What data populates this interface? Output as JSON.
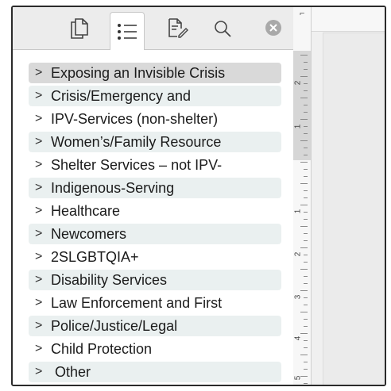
{
  "toolbar": {
    "tools": [
      {
        "icon": "page-thumbnails-icon"
      },
      {
        "icon": "outline-list-icon",
        "selected": true
      },
      {
        "icon": "annotations-icon"
      },
      {
        "icon": "search-icon"
      }
    ],
    "close_icon": "close-circle-icon"
  },
  "outline": {
    "items": [
      {
        "label": "Exposing an Invisible Crisis",
        "chevron": ">",
        "state": "selected"
      },
      {
        "label": "Crisis/Emergency and",
        "chevron": ">",
        "state": "alt"
      },
      {
        "label": "IPV-Services (non-shelter)",
        "chevron": ">",
        "state": ""
      },
      {
        "label": "Women’s/Family Resource",
        "chevron": ">",
        "state": "alt"
      },
      {
        "label": "Shelter Services – not IPV-",
        "chevron": ">",
        "state": ""
      },
      {
        "label": "Indigenous-Serving",
        "chevron": ">",
        "state": "alt"
      },
      {
        "label": "Healthcare",
        "chevron": ">",
        "state": ""
      },
      {
        "label": "Newcomers",
        "chevron": ">",
        "state": "alt"
      },
      {
        "label": "2SLGBTQIA+",
        "chevron": ">",
        "state": ""
      },
      {
        "label": "Disability Services",
        "chevron": ">",
        "state": "alt"
      },
      {
        "label": "Law Enforcement and First",
        "chevron": ">",
        "state": ""
      },
      {
        "label": "Police/Justice/Legal",
        "chevron": ">",
        "state": "alt"
      },
      {
        "label": "Child Protection",
        "chevron": ">",
        "state": ""
      },
      {
        "label": " Other",
        "chevron": ">",
        "state": "alt"
      }
    ]
  },
  "ruler": {
    "numbers": [
      "2",
      "1",
      "1",
      "2",
      "3",
      "4",
      "5"
    ],
    "marker": "⌐"
  }
}
